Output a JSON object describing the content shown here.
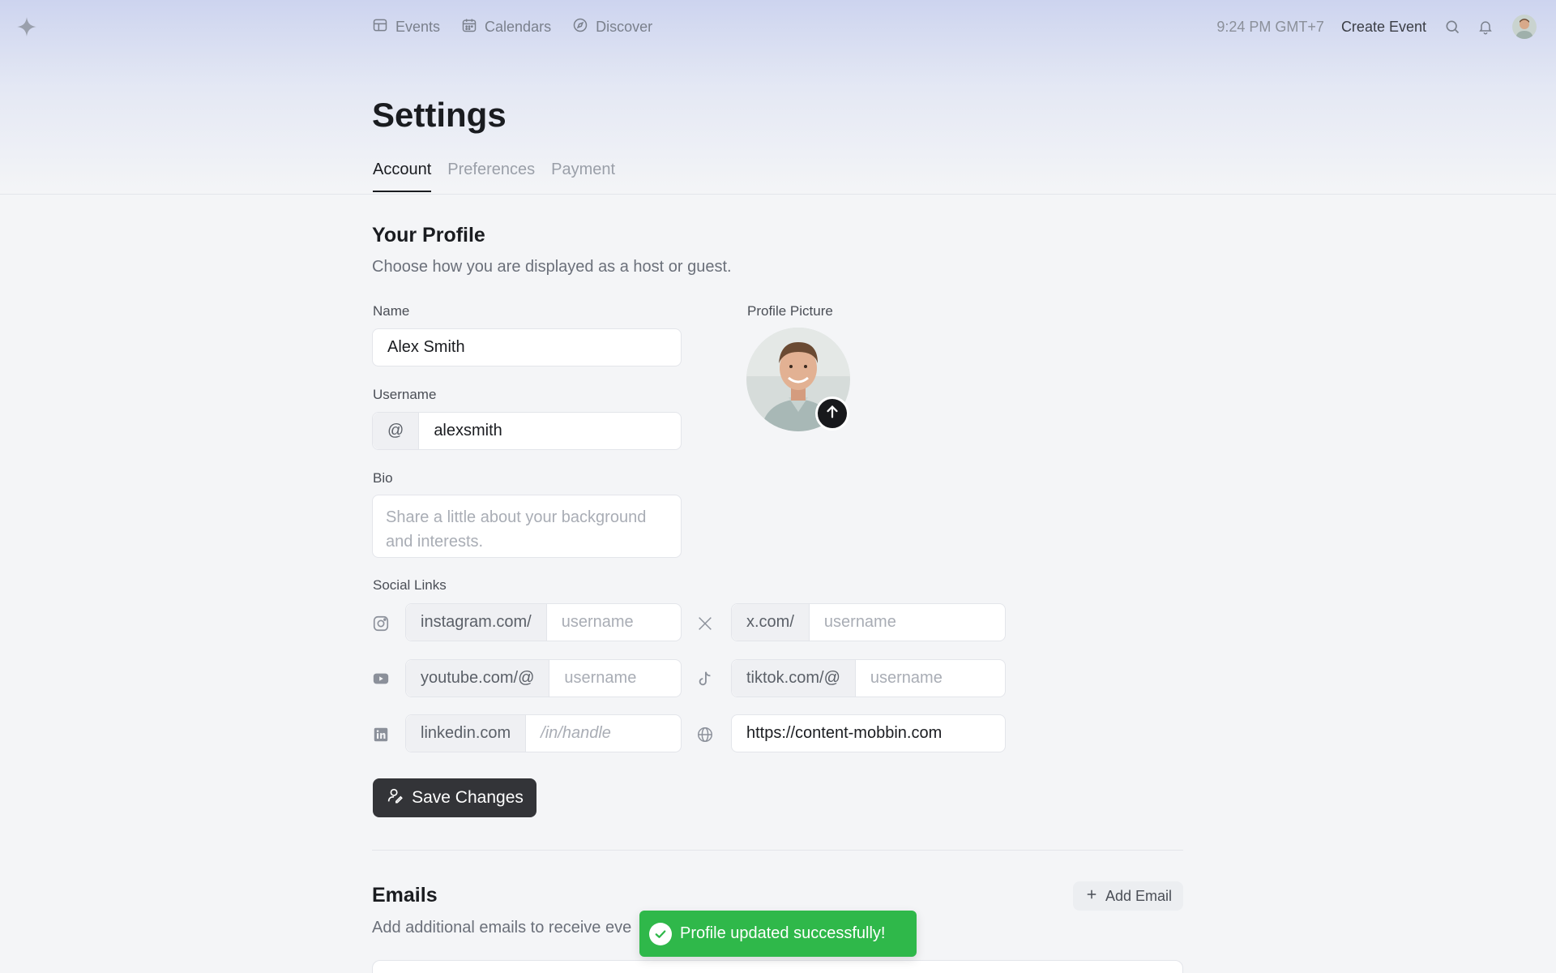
{
  "nav": {
    "logo": "sparkle-logo",
    "items": [
      {
        "label": "Events",
        "icon": "ticket-icon"
      },
      {
        "label": "Calendars",
        "icon": "calendar-icon"
      },
      {
        "label": "Discover",
        "icon": "compass-icon"
      }
    ],
    "time": "9:24 PM GMT+7",
    "create_event": "Create Event"
  },
  "page": {
    "title": "Settings",
    "tabs": [
      {
        "label": "Account",
        "active": true
      },
      {
        "label": "Preferences",
        "active": false
      },
      {
        "label": "Payment",
        "active": false
      }
    ]
  },
  "profile": {
    "title": "Your Profile",
    "subtitle": "Choose how you are displayed as a host or guest.",
    "name_label": "Name",
    "name_value": "Alex Smith",
    "username_label": "Username",
    "username_prefix": "@",
    "username_value": "alexsmith",
    "bio_label": "Bio",
    "bio_placeholder": "Share a little about your background and interests.",
    "picture_label": "Profile Picture"
  },
  "social": {
    "label": "Social Links",
    "links": [
      {
        "icon": "instagram-icon",
        "prefix": "instagram.com/",
        "placeholder": "username",
        "value": ""
      },
      {
        "icon": "x-icon",
        "prefix": "x.com/",
        "placeholder": "username",
        "value": ""
      },
      {
        "icon": "youtube-icon",
        "prefix": "youtube.com/@",
        "placeholder": "username",
        "value": ""
      },
      {
        "icon": "tiktok-icon",
        "prefix": "tiktok.com/@",
        "placeholder": "username",
        "value": ""
      },
      {
        "icon": "linkedin-icon",
        "prefix": "linkedin.com",
        "placeholder": "/in/handle",
        "value": ""
      },
      {
        "icon": "globe-icon",
        "prefix": "",
        "placeholder": "",
        "value": "https://content-mobbin.com"
      }
    ]
  },
  "save_label": "Save Changes",
  "emails": {
    "title": "Emails",
    "subtitle": "Add additional emails to receive eve",
    "add_label": "Add Email"
  },
  "toast": {
    "message": "Profile updated successfully!"
  },
  "colors": {
    "accent_dark": "#333438",
    "toast_green": "#2fb84a",
    "header_gradient_top": "#cdd4ef"
  }
}
